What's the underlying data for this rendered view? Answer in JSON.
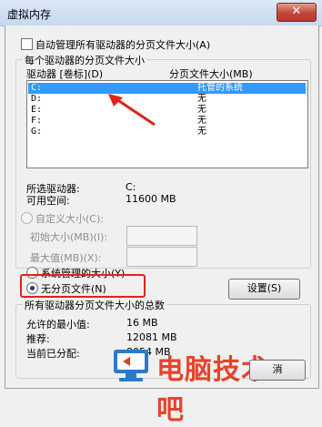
{
  "window": {
    "title": "虚拟内存",
    "close_label": "✕"
  },
  "auto_manage": {
    "label": "自动管理所有驱动器的分页文件大小(A)",
    "checked": false
  },
  "per_drive": {
    "group_title": "每个驱动器的分页文件大小",
    "col_drive": "驱动器 [卷标](D)",
    "col_size": "分页文件大小(MB)",
    "drives": [
      {
        "letter": "C:",
        "size": "托管的系统",
        "selected": true
      },
      {
        "letter": "D:",
        "size": "无",
        "selected": false
      },
      {
        "letter": "E:",
        "size": "无",
        "selected": false
      },
      {
        "letter": "F:",
        "size": "无",
        "selected": false
      },
      {
        "letter": "G:",
        "size": "无",
        "selected": false
      }
    ],
    "selected_drive_label": "所选驱动器:",
    "selected_drive_value": "C:",
    "free_space_label": "可用空间:",
    "free_space_value": "11600 MB",
    "custom_size_label": "自定义大小(C):",
    "initial_size_label": "初始大小(MB)(I):",
    "initial_size_value": "",
    "max_size_label": "最大值(MB)(X):",
    "max_size_value": "",
    "system_managed_label": "系统管理的大小(Y)",
    "no_paging_label": "无分页文件(N)",
    "set_button": "设置(S)"
  },
  "totals": {
    "group_title": "所有驱动器分页文件大小的总数",
    "min_allowed_label": "允许的最小值:",
    "min_allowed_value": "16 MB",
    "recommended_label": "推荐:",
    "recommended_value": "12081 MB",
    "current_label": "当前已分配:",
    "current_value": "8054 MB"
  },
  "buttons": {
    "cancel_partial": "消"
  },
  "watermark": {
    "text": "电脑技术吧"
  },
  "colors": {
    "selection": "#3399ff",
    "annotation_red": "#e2231a",
    "watermark_red": "#e53b21",
    "watermark_blue": "#2a7bc8"
  }
}
